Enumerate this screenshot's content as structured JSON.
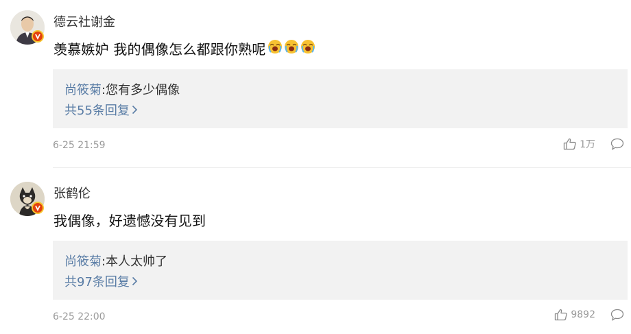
{
  "comments": [
    {
      "username": "德云社谢金",
      "text": "羡慕嫉妒 我的偶像怎么都跟你熟呢",
      "emojis": [
        "crying-face-emoji",
        "crying-face-emoji",
        "crying-face-emoji"
      ],
      "reply": {
        "author": "尚筱菊",
        "separator": ":",
        "text": "您有多少偶像",
        "count_label": "共55条回复"
      },
      "time": "6-25 21:59",
      "likes": "1万"
    },
    {
      "username": "张鹤伦",
      "text": "我偶像，好遗憾没有见到",
      "emojis": [],
      "reply": {
        "author": "尚筱菊",
        "separator": ":",
        "text": "本人太帅了",
        "count_label": "共97条回复"
      },
      "time": "6-25 22:00",
      "likes": "9892"
    }
  ],
  "colors": {
    "link": "#5a7da6",
    "muted": "#999999",
    "reply_bg": "#f2f2f2",
    "verified_badge": "#e3410c"
  }
}
